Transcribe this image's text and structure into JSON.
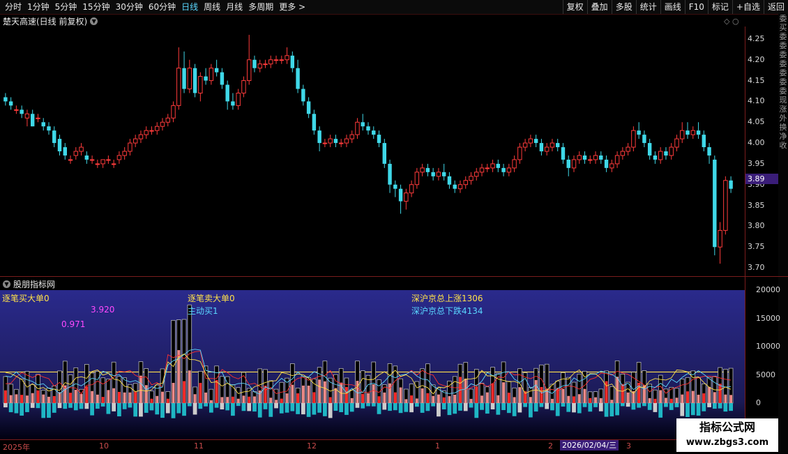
{
  "toolbar": {
    "tabs": [
      "分时",
      "1分钟",
      "5分钟",
      "15分钟",
      "30分钟",
      "60分钟",
      "日线",
      "周线",
      "月线",
      "多周期",
      "更多 >"
    ],
    "active_tab": "日线",
    "right_buttons": [
      "复权",
      "叠加",
      "多股",
      "统计",
      "画线",
      "F10",
      "标记",
      "+自选",
      "返回"
    ]
  },
  "chart": {
    "title": "楚天高速(日线 前复权)",
    "price_ticks": [
      "4.25",
      "4.20",
      "4.15",
      "4.10",
      "4.05",
      "4.00",
      "3.95",
      "3.90",
      "3.85",
      "3.80",
      "3.75",
      "3.70"
    ],
    "current_price": "3.89"
  },
  "indicator": {
    "title": "股朋指标网",
    "labels": {
      "big_buy": "逐笔买大单0",
      "big_sell": "逐笔卖大单0",
      "active_buy": "主动买1",
      "up_count": "深沪京总上涨1306",
      "down_count": "深沪京总下跌4134",
      "v1": "3.920",
      "v2": "0.971"
    },
    "axis_ticks": [
      "20000",
      "15000",
      "10000",
      "5000",
      "0"
    ]
  },
  "dates": {
    "labels": [
      "2025年",
      "10",
      "11",
      "12",
      "1",
      "2",
      "3"
    ],
    "cursor_date": "2026/02/04/三"
  },
  "side_strip": [
    "委",
    "买",
    "委",
    "委",
    "委",
    "委",
    "委",
    "委",
    "委",
    "现",
    "涨",
    "外",
    "换",
    "净",
    "收"
  ],
  "watermark": {
    "line1": "指标公式网",
    "line2": "www.zbgs3.com"
  },
  "colors": {
    "up": "#ff3b3b",
    "down": "#3fd8e8",
    "accent": "#5ad7ff",
    "indicator_bg_top": "#2a2a8c",
    "indicator_bg_bottom": "#000010"
  },
  "chart_data": {
    "type": "candlestick",
    "candles": [
      [
        4.11,
        4.12,
        4.09,
        4.1
      ],
      [
        4.1,
        4.11,
        4.08,
        4.09
      ],
      [
        4.08,
        4.09,
        4.07,
        4.08
      ],
      [
        4.08,
        4.09,
        4.06,
        4.07
      ],
      [
        4.06,
        4.08,
        4.04,
        4.07
      ],
      [
        4.07,
        4.08,
        4.04,
        4.04
      ],
      [
        4.06,
        4.07,
        4.05,
        4.06
      ],
      [
        4.05,
        4.06,
        4.03,
        4.04
      ],
      [
        4.04,
        4.05,
        4.02,
        4.03
      ],
      [
        4.03,
        4.04,
        3.99,
        4.0
      ],
      [
        4.01,
        4.02,
        3.97,
        3.98
      ],
      [
        3.99,
        4.0,
        3.96,
        3.97
      ],
      [
        3.96,
        3.97,
        3.95,
        3.96
      ],
      [
        3.97,
        3.99,
        3.96,
        3.98
      ],
      [
        3.98,
        4.0,
        3.97,
        3.99
      ],
      [
        3.97,
        3.98,
        3.95,
        3.96
      ],
      [
        3.96,
        3.97,
        3.95,
        3.96
      ],
      [
        3.95,
        3.96,
        3.94,
        3.95
      ],
      [
        3.95,
        3.96,
        3.94,
        3.96
      ],
      [
        3.96,
        3.97,
        3.95,
        3.96
      ],
      [
        3.95,
        3.96,
        3.94,
        3.95
      ],
      [
        3.96,
        3.98,
        3.95,
        3.97
      ],
      [
        3.97,
        3.99,
        3.96,
        3.98
      ],
      [
        3.98,
        4.01,
        3.97,
        4.0
      ],
      [
        4.0,
        4.02,
        3.99,
        4.01
      ],
      [
        4.01,
        4.03,
        4.0,
        4.02
      ],
      [
        4.02,
        4.04,
        4.01,
        4.03
      ],
      [
        4.03,
        4.04,
        4.02,
        4.03
      ],
      [
        4.03,
        4.05,
        4.02,
        4.04
      ],
      [
        4.04,
        4.06,
        4.03,
        4.05
      ],
      [
        4.05,
        4.07,
        4.04,
        4.06
      ],
      [
        4.06,
        4.1,
        4.05,
        4.09
      ],
      [
        4.09,
        4.23,
        4.08,
        4.18
      ],
      [
        4.18,
        4.22,
        4.12,
        4.13
      ],
      [
        4.13,
        4.2,
        4.12,
        4.18
      ],
      [
        4.18,
        4.19,
        4.11,
        4.12
      ],
      [
        4.12,
        4.17,
        4.1,
        4.16
      ],
      [
        4.16,
        4.18,
        4.14,
        4.15
      ],
      [
        4.15,
        4.19,
        4.14,
        4.18
      ],
      [
        4.18,
        4.2,
        4.16,
        4.17
      ],
      [
        4.17,
        4.18,
        4.13,
        4.14
      ],
      [
        4.14,
        4.15,
        4.08,
        4.1
      ],
      [
        4.1,
        4.12,
        4.08,
        4.09
      ],
      [
        4.09,
        4.13,
        4.08,
        4.12
      ],
      [
        4.12,
        4.16,
        4.11,
        4.15
      ],
      [
        4.15,
        4.26,
        4.14,
        4.2
      ],
      [
        4.2,
        4.21,
        4.17,
        4.18
      ],
      [
        4.18,
        4.2,
        4.17,
        4.19
      ],
      [
        4.19,
        4.2,
        4.18,
        4.19
      ],
      [
        4.19,
        4.21,
        4.18,
        4.2
      ],
      [
        4.2,
        4.21,
        4.19,
        4.2
      ],
      [
        4.2,
        4.21,
        4.19,
        4.2
      ],
      [
        4.2,
        4.23,
        4.19,
        4.21
      ],
      [
        4.21,
        4.22,
        4.17,
        4.18
      ],
      [
        4.18,
        4.2,
        4.12,
        4.13
      ],
      [
        4.13,
        4.14,
        4.09,
        4.1
      ],
      [
        4.1,
        4.11,
        4.06,
        4.07
      ],
      [
        4.07,
        4.08,
        4.02,
        4.03
      ],
      [
        4.03,
        4.04,
        3.98,
        4.0
      ],
      [
        4.0,
        4.01,
        3.99,
        4.0
      ],
      [
        4.0,
        4.02,
        3.99,
        4.01
      ],
      [
        4.01,
        4.02,
        3.99,
        4.0
      ],
      [
        4.0,
        4.01,
        3.99,
        4.0
      ],
      [
        4.0,
        4.02,
        3.99,
        4.01
      ],
      [
        4.01,
        4.03,
        4.0,
        4.02
      ],
      [
        4.02,
        4.06,
        4.01,
        4.05
      ],
      [
        4.05,
        4.07,
        4.03,
        4.04
      ],
      [
        4.04,
        4.05,
        4.02,
        4.03
      ],
      [
        4.03,
        4.04,
        4.01,
        4.02
      ],
      [
        4.02,
        4.03,
        3.99,
        4.0
      ],
      [
        4.0,
        4.01,
        3.94,
        3.95
      ],
      [
        3.95,
        3.96,
        3.88,
        3.9
      ],
      [
        3.9,
        3.91,
        3.87,
        3.89
      ],
      [
        3.89,
        3.9,
        3.83,
        3.86
      ],
      [
        3.86,
        3.89,
        3.84,
        3.88
      ],
      [
        3.88,
        3.91,
        3.87,
        3.9
      ],
      [
        3.9,
        3.94,
        3.89,
        3.93
      ],
      [
        3.93,
        3.95,
        3.92,
        3.94
      ],
      [
        3.94,
        3.95,
        3.92,
        3.93
      ],
      [
        3.93,
        3.94,
        3.91,
        3.92
      ],
      [
        3.92,
        3.94,
        3.91,
        3.93
      ],
      [
        3.93,
        3.95,
        3.91,
        3.92
      ],
      [
        3.92,
        3.93,
        3.89,
        3.9
      ],
      [
        3.9,
        3.91,
        3.88,
        3.89
      ],
      [
        3.89,
        3.91,
        3.88,
        3.9
      ],
      [
        3.9,
        3.92,
        3.89,
        3.91
      ],
      [
        3.91,
        3.93,
        3.9,
        3.92
      ],
      [
        3.92,
        3.94,
        3.91,
        3.93
      ],
      [
        3.93,
        3.95,
        3.92,
        3.94
      ],
      [
        3.94,
        3.95,
        3.93,
        3.94
      ],
      [
        3.94,
        3.96,
        3.93,
        3.95
      ],
      [
        3.95,
        3.96,
        3.93,
        3.94
      ],
      [
        3.94,
        3.95,
        3.92,
        3.93
      ],
      [
        3.93,
        3.95,
        3.92,
        3.94
      ],
      [
        3.94,
        3.97,
        3.93,
        3.96
      ],
      [
        3.96,
        4.0,
        3.95,
        3.99
      ],
      [
        3.99,
        4.01,
        3.98,
        4.0
      ],
      [
        4.0,
        4.02,
        3.99,
        4.01
      ],
      [
        4.01,
        4.02,
        3.99,
        4.0
      ],
      [
        4.0,
        4.01,
        3.97,
        3.98
      ],
      [
        3.98,
        4.0,
        3.97,
        3.99
      ],
      [
        3.99,
        4.01,
        3.98,
        4.0
      ],
      [
        4.0,
        4.01,
        3.98,
        3.99
      ],
      [
        3.99,
        4.0,
        3.95,
        3.96
      ],
      [
        3.96,
        3.97,
        3.92,
        3.94
      ],
      [
        3.94,
        3.97,
        3.93,
        3.96
      ],
      [
        3.96,
        3.98,
        3.95,
        3.97
      ],
      [
        3.97,
        3.98,
        3.95,
        3.96
      ],
      [
        3.96,
        3.97,
        3.95,
        3.96
      ],
      [
        3.96,
        3.98,
        3.95,
        3.97
      ],
      [
        3.97,
        3.98,
        3.95,
        3.96
      ],
      [
        3.96,
        3.97,
        3.93,
        3.94
      ],
      [
        3.94,
        3.96,
        3.93,
        3.95
      ],
      [
        3.95,
        3.98,
        3.94,
        3.97
      ],
      [
        3.97,
        3.99,
        3.96,
        3.98
      ],
      [
        3.98,
        4.0,
        3.97,
        3.99
      ],
      [
        3.99,
        4.04,
        3.98,
        4.03
      ],
      [
        4.03,
        4.05,
        4.01,
        4.02
      ],
      [
        4.02,
        4.03,
        3.99,
        4.0
      ],
      [
        4.0,
        4.01,
        3.96,
        3.97
      ],
      [
        3.97,
        3.98,
        3.95,
        3.96
      ],
      [
        3.96,
        3.99,
        3.95,
        3.98
      ],
      [
        3.98,
        3.99,
        3.96,
        3.97
      ],
      [
        3.97,
        4.0,
        3.96,
        3.99
      ],
      [
        3.99,
        4.02,
        3.98,
        4.01
      ],
      [
        4.01,
        4.05,
        4.0,
        4.03
      ],
      [
        4.03,
        4.05,
        4.01,
        4.02
      ],
      [
        4.02,
        4.04,
        4.01,
        4.03
      ],
      [
        4.03,
        4.05,
        4.01,
        4.02
      ],
      [
        4.02,
        4.03,
        3.98,
        3.99
      ],
      [
        3.99,
        4.0,
        3.95,
        3.97
      ],
      [
        3.96,
        3.97,
        3.73,
        3.75
      ],
      [
        3.75,
        3.81,
        3.71,
        3.79
      ],
      [
        3.79,
        3.92,
        3.78,
        3.91
      ],
      [
        3.91,
        3.92,
        3.88,
        3.89
      ]
    ]
  }
}
